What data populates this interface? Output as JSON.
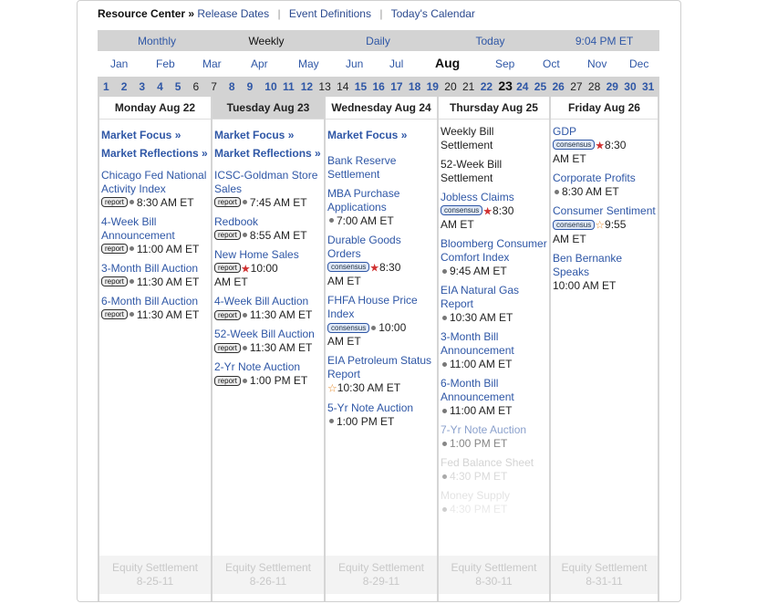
{
  "nav": {
    "title": "Resource Center »",
    "links": [
      "Release Dates",
      "Event Definitions",
      "Today's Calendar"
    ]
  },
  "views": {
    "monthly": "Monthly",
    "weekly": "Weekly",
    "daily": "Daily",
    "today": "Today",
    "time": "9:04 PM ET"
  },
  "months": [
    "Jan",
    "Feb",
    "Mar",
    "Apr",
    "May",
    "Jun",
    "Jul",
    "Aug",
    "Sep",
    "Oct",
    "Nov",
    "Dec"
  ],
  "selected_month": "Aug",
  "days": [
    "1",
    "2",
    "3",
    "4",
    "5",
    "6",
    "7",
    "8",
    "9",
    "10",
    "11",
    "12",
    "13",
    "14",
    "15",
    "16",
    "17",
    "18",
    "19",
    "20",
    "21",
    "22",
    "23",
    "24",
    "25",
    "26",
    "27",
    "28",
    "29",
    "30",
    "31"
  ],
  "today_day": "23",
  "weekend_days": [
    "6",
    "7",
    "13",
    "14",
    "20",
    "21",
    "27",
    "28"
  ],
  "columns": [
    {
      "header": "Monday Aug 22",
      "focus": "Market Focus »",
      "reflections": "Market Reflections »",
      "items": [
        {
          "title": "Chicago Fed National Activity Index",
          "badge": "report",
          "time": "8:30 AM ET"
        },
        {
          "title": "4-Week Bill Announcement",
          "badge": "report",
          "time": "11:00 AM ET"
        },
        {
          "title": "3-Month Bill Auction",
          "badge": "report",
          "time": "11:30 AM ET"
        },
        {
          "title": "6-Month Bill Auction",
          "badge": "report",
          "time": "11:30 AM ET"
        }
      ],
      "footer": [
        "Equity Settlement",
        "8-25-11"
      ]
    },
    {
      "header": "Tuesday Aug 23",
      "focus": "Market Focus »",
      "reflections": "Market Reflections »",
      "items": [
        {
          "title": "ICSC-Goldman Store Sales",
          "badge": "report",
          "time": "7:45 AM ET"
        },
        {
          "title": "Redbook",
          "badge": "report",
          "time": "8:55 AM ET"
        },
        {
          "title": "New Home Sales",
          "badge": "report",
          "star": "red",
          "time": "10:00",
          "time2": "AM ET"
        },
        {
          "title": "4-Week Bill Auction",
          "badge": "report",
          "time": "11:30 AM ET"
        },
        {
          "title": "52-Week Bill Auction",
          "badge": "report",
          "time": "11:30 AM ET"
        },
        {
          "title": "2-Yr Note Auction",
          "badge": "report",
          "time": "1:00 PM ET"
        }
      ],
      "footer": [
        "Equity Settlement",
        "8-26-11"
      ]
    },
    {
      "header": "Wednesday Aug 24",
      "focus": "Market Focus »",
      "items": [
        {
          "title": "Bank Reserve Settlement"
        },
        {
          "title": "MBA Purchase Applications",
          "time": "7:00 AM ET"
        },
        {
          "title": "Durable Goods Orders",
          "badge": "consensus",
          "star": "red",
          "time": "8:30",
          "time2": "AM ET"
        },
        {
          "title": "FHFA House Price Index",
          "badge": "consensus",
          "time": "10:00",
          "time2": "AM ET"
        },
        {
          "title": "EIA Petroleum Status Report",
          "star": "hollow",
          "time": "10:30 AM ET"
        },
        {
          "title": "5-Yr Note Auction",
          "time": "1:00 PM ET"
        }
      ],
      "footer": [
        "Equity Settlement",
        "8-29-11"
      ]
    },
    {
      "header": "Thursday Aug 25",
      "items": [
        {
          "plain": "Weekly Bill Settlement"
        },
        {
          "plain": "52-Week Bill Settlement"
        },
        {
          "title": "Jobless Claims",
          "badge": "consensus",
          "star": "red",
          "time": "8:30",
          "time2": "AM ET"
        },
        {
          "title": "Bloomberg Consumer Comfort Index",
          "time": "9:45 AM ET"
        },
        {
          "title": "EIA Natural Gas Report",
          "time": "10:30 AM ET"
        },
        {
          "title": "3-Month Bill Announcement",
          "time": "11:00 AM ET"
        },
        {
          "title": "6-Month Bill Announcement",
          "time": "11:00 AM ET"
        },
        {
          "title": "7-Yr Note Auction",
          "time": "1:00 PM ET",
          "fade": 1
        },
        {
          "title": "Fed Balance Sheet",
          "time": "4:30 PM ET",
          "fade": 2
        },
        {
          "title": "Money Supply",
          "time": "4:30 PM ET",
          "fade": 2
        }
      ],
      "footer": [
        "Equity Settlement",
        "8-30-11"
      ]
    },
    {
      "header": "Friday Aug 26",
      "items": [
        {
          "title": "GDP",
          "badge": "consensus",
          "star": "red",
          "time": "8:30",
          "time2": "AM ET"
        },
        {
          "title": "Corporate Profits",
          "time": "8:30 AM ET"
        },
        {
          "title": "Consumer Sentiment",
          "badge": "consensus",
          "star": "hollow",
          "time": "9:55",
          "time2": "AM ET"
        },
        {
          "title": "Ben Bernanke Speaks",
          "time": "10:00 AM ET",
          "nodot": true
        }
      ],
      "footer": [
        "Equity Settlement",
        "8-31-11"
      ]
    }
  ]
}
